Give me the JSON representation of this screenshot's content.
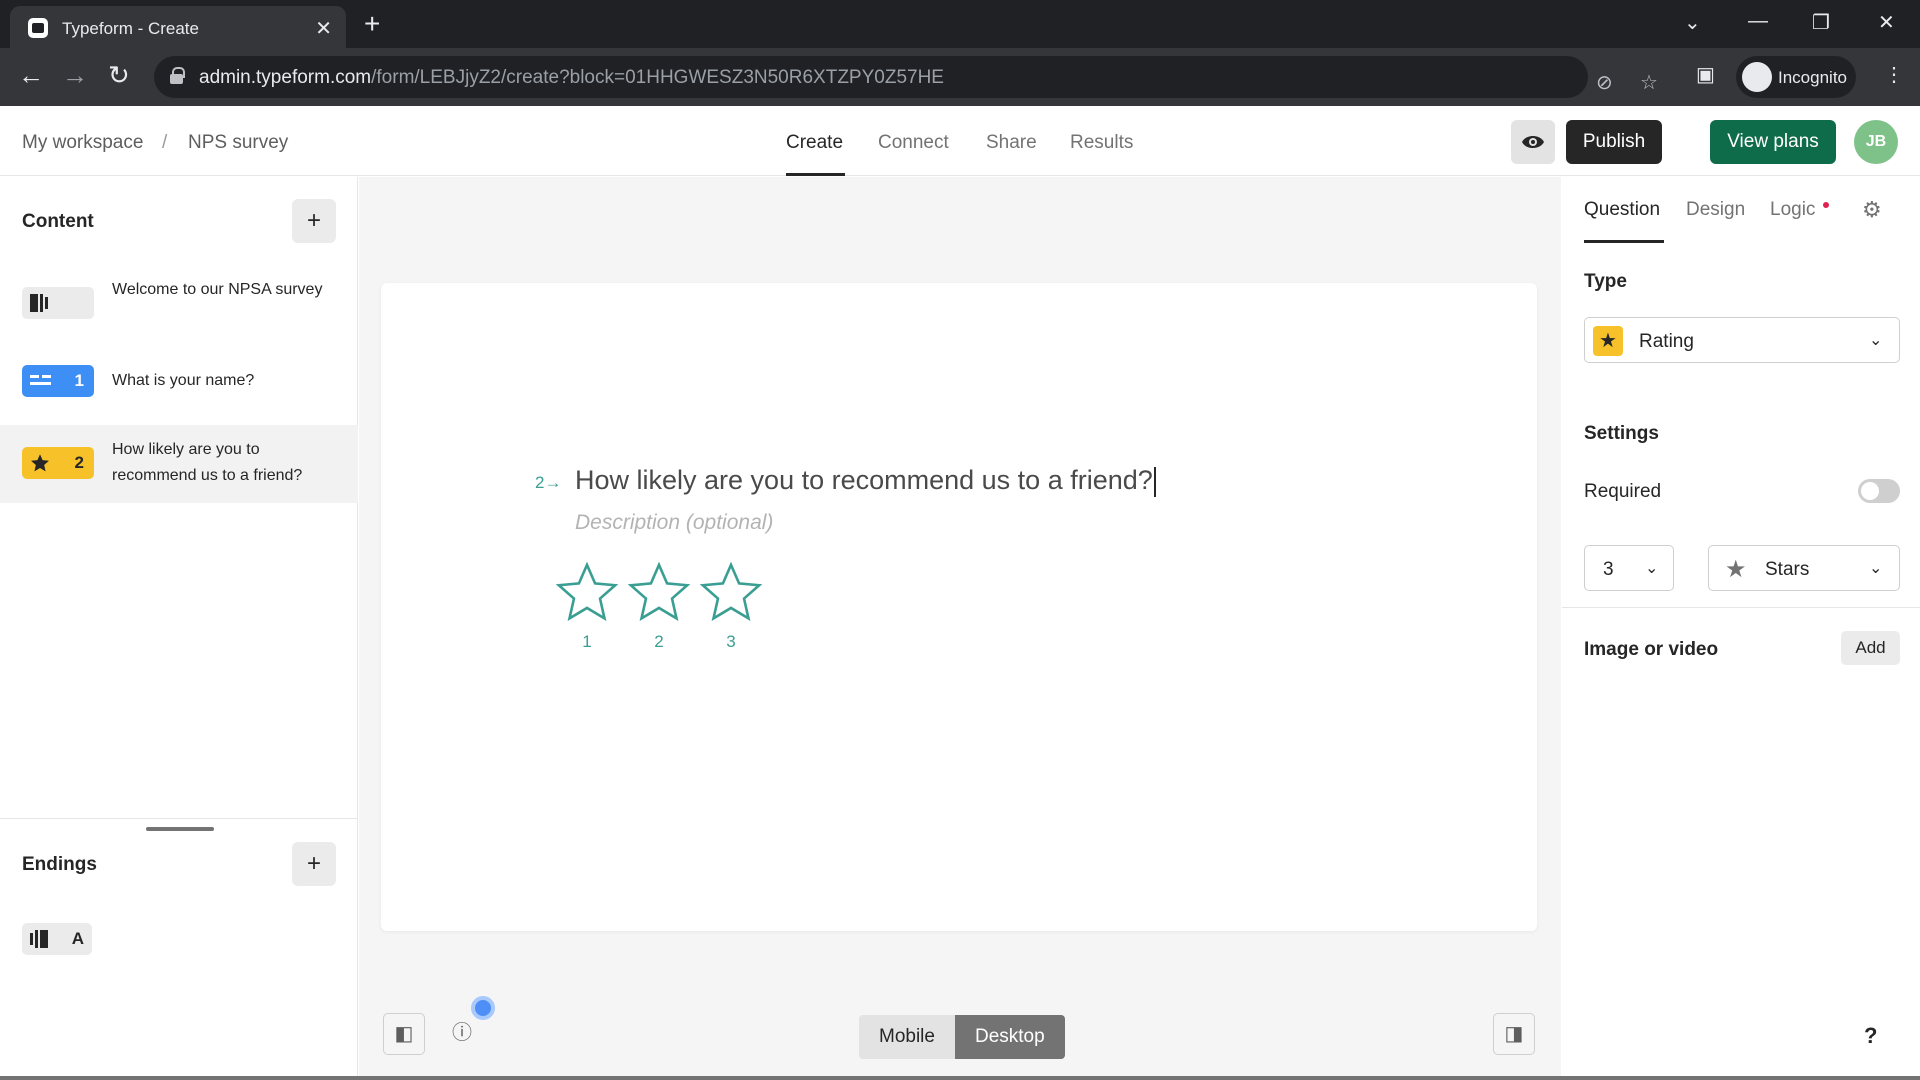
{
  "browser": {
    "tab_title": "Typeform - Create",
    "tab_close": "✕",
    "new_tab": "+",
    "url_host": "admin.typeform.com",
    "url_path": "/form/LEBJjyZ2/create?block=01HHGWESZ3N50R6XTZPY0Z57HE",
    "incognito_label": "Incognito",
    "win_controls": [
      "⌄",
      "—",
      "❐",
      "✕"
    ]
  },
  "header": {
    "breadcrumb_workspace": "My workspace",
    "breadcrumb_sep": "/",
    "breadcrumb_form": "NPS survey",
    "tabs": [
      "Create",
      "Connect",
      "Share",
      "Results"
    ],
    "active_tab": "Create",
    "publish_label": "Publish",
    "view_plans_label": "View plans",
    "avatar_initials": "JB",
    "accent_color": "#0e6c4a"
  },
  "sidebar": {
    "content_title": "Content",
    "add_symbol": "+",
    "items": [
      {
        "label": "Welcome to our NPSA survey",
        "num": "",
        "badge_color": "#ebebeb",
        "icon": "welcome-screen-icon"
      },
      {
        "label": "What is your name?",
        "num": "1",
        "badge_color": "#3d8ff5",
        "icon": "short-text-icon"
      },
      {
        "label": "How likely are you to recommend us to a friend?",
        "num": "2",
        "badge_color": "#f7c229",
        "icon": "star-icon"
      }
    ],
    "endings_title": "Endings",
    "ending_letter": "A"
  },
  "canvas": {
    "question_number": "2→",
    "question_text": "How likely are you to recommend us to a friend?",
    "description_placeholder": "Description (optional)",
    "stars": [
      "1",
      "2",
      "3"
    ],
    "star_color": "#3a9e93",
    "device_mobile": "Mobile",
    "device_desktop": "Desktop",
    "active_device": "Desktop"
  },
  "right_panel": {
    "tabs": [
      "Question",
      "Design",
      "Logic"
    ],
    "active_tab": "Question",
    "type_label": "Type",
    "type_value": "Rating",
    "settings_label": "Settings",
    "required_label": "Required",
    "required_on": false,
    "steps_value": "3",
    "shape_value": "Stars",
    "media_label": "Image or video",
    "add_label": "Add",
    "help": "?"
  }
}
